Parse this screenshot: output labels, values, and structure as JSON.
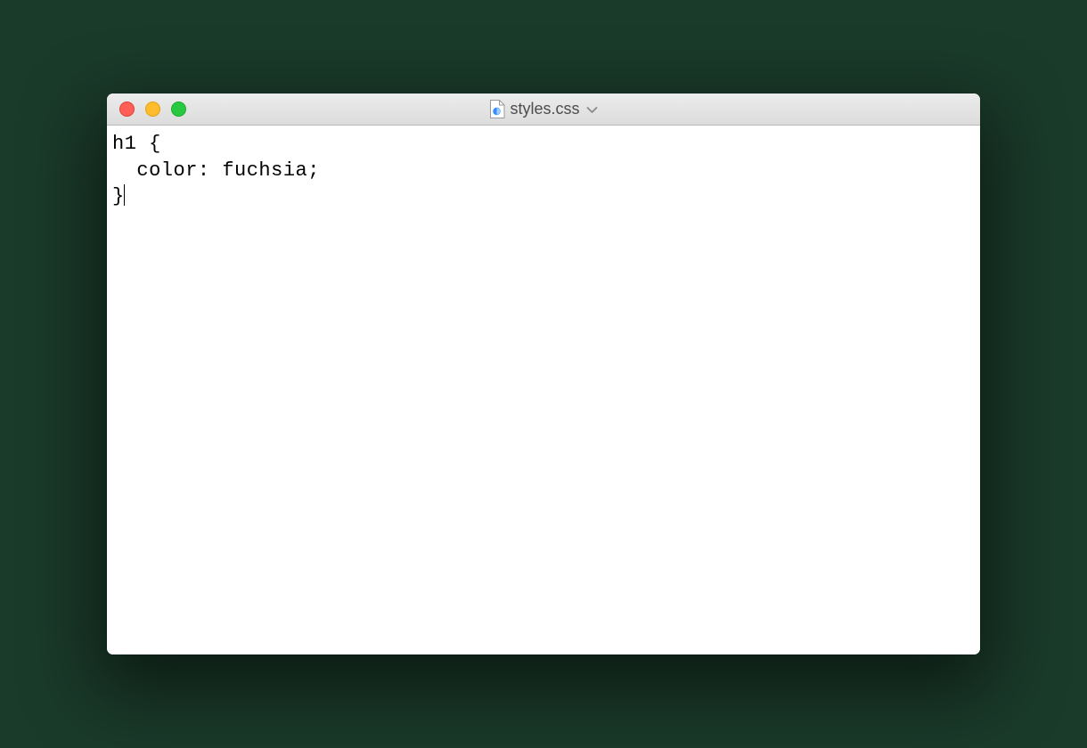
{
  "window": {
    "title": "styles.css",
    "traffic_lights": {
      "close": "close",
      "minimize": "minimize",
      "zoom": "zoom"
    }
  },
  "editor": {
    "content": "h1 {\n  color: fuchsia;\n}",
    "line1": "h1 {",
    "line2": "  color: fuchsia;",
    "line3": "}",
    "cursor_after_line": 3
  }
}
